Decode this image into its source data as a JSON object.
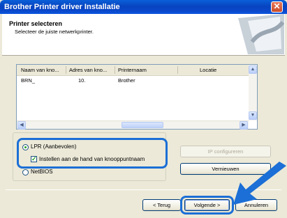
{
  "window": {
    "title": "Brother Printer driver Installatie",
    "close_glyph": "✕"
  },
  "header": {
    "title": "Printer selecteren",
    "subtitle": "Selecteer de juiste netwerkprinter."
  },
  "printer_list": {
    "columns": [
      "Naam van kno...",
      "Adres van kno...",
      "Printernaam",
      "Locatie"
    ],
    "rows": [
      {
        "name": "BRN_",
        "address": "10.",
        "printer": "Brother",
        "location": ""
      }
    ]
  },
  "options": {
    "lpr_label": "LPR (Aanbevolen)",
    "manual_label": "Instellen aan de hand van knooppuntnaam",
    "netbios_label": "NetBIOS"
  },
  "buttons": {
    "ip_config": "IP configureren",
    "refresh": "Vernieuwen",
    "back": "< Terug",
    "next": "Volgende >",
    "cancel": "Annuleren"
  },
  "colors": {
    "highlight": "#1b6fd6",
    "titlebar": "#0844c0"
  }
}
